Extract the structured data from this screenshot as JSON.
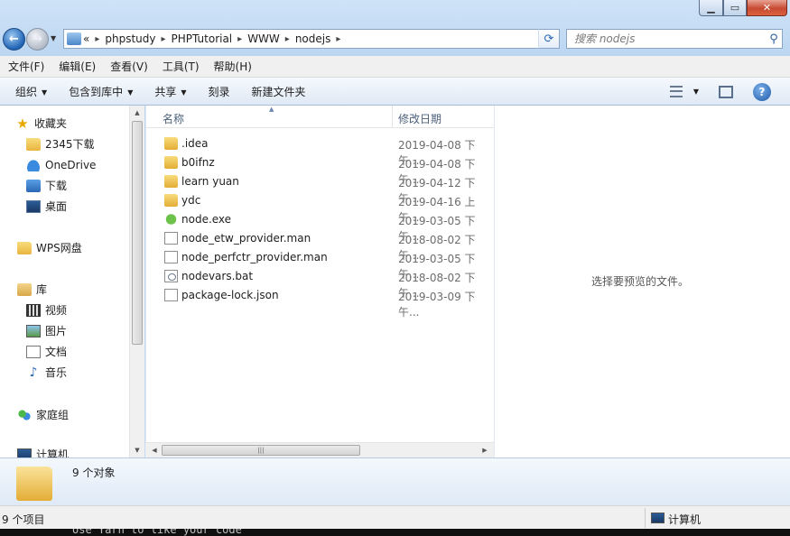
{
  "address": {
    "prefix": "«",
    "crumbs": [
      "phpstudy",
      "PHPTutorial",
      "WWW",
      "nodejs"
    ],
    "separator": "▸"
  },
  "search": {
    "placeholder": "搜索 nodejs"
  },
  "menubar": [
    "文件(F)",
    "编辑(E)",
    "查看(V)",
    "工具(T)",
    "帮助(H)"
  ],
  "commandbar": {
    "organize": "组织",
    "include_library": "包含到库中",
    "share": "共享",
    "burn": "刻录",
    "new_folder": "新建文件夹"
  },
  "navpane": {
    "favorites": "收藏夹",
    "fav_items": [
      "2345下载",
      "OneDrive",
      "下载",
      "桌面"
    ],
    "wps": "WPS网盘",
    "libraries": "库",
    "lib_items": [
      "视频",
      "图片",
      "文档",
      "音乐"
    ],
    "homegroup": "家庭组",
    "computer": "计算机"
  },
  "filelist": {
    "col_name": "名称",
    "col_date": "修改日期",
    "rows": [
      {
        "name": ".idea",
        "date": "2019-04-08 下午...",
        "icon": "folder-icon"
      },
      {
        "name": "b0ifnz",
        "date": "2019-04-08 下午...",
        "icon": "folder-icon"
      },
      {
        "name": "learn yuan",
        "date": "2019-04-12 下午...",
        "icon": "folder-icon"
      },
      {
        "name": "ydc",
        "date": "2019-04-16 上午...",
        "icon": "folder-icon"
      },
      {
        "name": "node.exe",
        "date": "2019-03-05 下午...",
        "icon": "node-exe-icon"
      },
      {
        "name": "node_etw_provider.man",
        "date": "2018-08-02 下午...",
        "icon": "file-icon"
      },
      {
        "name": "node_perfctr_provider.man",
        "date": "2019-03-05 下午...",
        "icon": "file-icon"
      },
      {
        "name": "nodevars.bat",
        "date": "2018-08-02 下午...",
        "icon": "bat-file-icon"
      },
      {
        "name": "package-lock.json",
        "date": "2019-03-09 下午...",
        "icon": "file-icon"
      }
    ]
  },
  "preview": {
    "text": "选择要预览的文件。"
  },
  "details": {
    "text": "9 个对象"
  },
  "statusbar": {
    "left": "9 个项目",
    "right": "计算机"
  },
  "terminal": {
    "text": "Use Yarn to like your code"
  }
}
